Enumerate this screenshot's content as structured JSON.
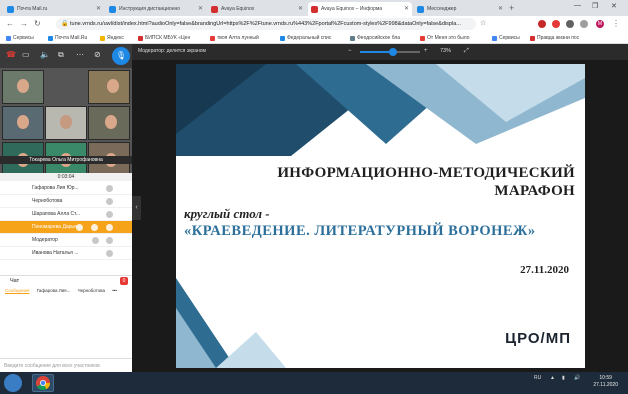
{
  "browser": {
    "tabs": [
      {
        "label": "Почта Mail.ru",
        "color": "#1e88e5"
      },
      {
        "label": "Инструкция дистанционно",
        "color": "#1e88e5"
      },
      {
        "label": "Avaya Equinox",
        "color": "#d32f2f"
      },
      {
        "label": "Avaya Equinox – Информа",
        "color": "#d32f2f"
      },
      {
        "label": "Мессенджер",
        "color": "#1e88e5"
      }
    ],
    "new_tab": "+",
    "url": "tune.vrnds.ru/uwl/dist/index.html?audioOnly=false&brandingUrl=https%2F%2Ftune.vrnds.ru%443%2Fportal%2Fcustom-styles%2F998&dataOnly=false&displa...",
    "avatar_letter": "M"
  },
  "bookmarks": [
    {
      "label": "Сервисы",
      "color": "#4285f4"
    },
    {
      "label": "Почта Mail.Ru",
      "color": "#1e88e5"
    },
    {
      "label": "Яндекс",
      "color": "#f4b400"
    },
    {
      "label": "БИПСК МБУК «Цен",
      "color": "#d32f2f"
    },
    {
      "label": "твоя Алта лунный",
      "color": "#e53935"
    },
    {
      "label": "Федеральный спис",
      "color": "#1e88e5"
    },
    {
      "label": "Феодосийское бла",
      "color": "#607d8b"
    },
    {
      "label": "От Меня это было",
      "color": "#e53935"
    },
    {
      "label": "Сервисы",
      "color": "#4285f4"
    },
    {
      "label": "Правда жизни пос",
      "color": "#d32f2f"
    }
  ],
  "meeting": {
    "moderator_label": "Модератор: делится экраном",
    "zoom": "73%",
    "zoom_fraction": 0.55,
    "active_speaker": "Токарева Ольга Митрофановна",
    "timer": "0:03:04",
    "participants": [
      {
        "name": "Гафарова Лия Юр..."
      },
      {
        "name": "Черноботова"
      },
      {
        "name": "Шарапова Алла Ст..."
      },
      {
        "name": "Пономарева Дарья ...",
        "highlighted": true
      },
      {
        "name": "Модератор"
      },
      {
        "name": "Иванова Наталья ..."
      }
    ],
    "chat": {
      "title": "Чат",
      "badge": "0",
      "tabs": [
        "Сообщения",
        "Гафарова Лия...",
        "Черноботова",
        "•••"
      ],
      "input_placeholder": "Введите сообщение для всех участников"
    }
  },
  "slide": {
    "title": "ИНФОРМАЦИОННО-МЕТОДИЧЕСКИЙ МАРАФОН",
    "subtitle_line1": "круглый стол -",
    "subtitle_line2": "«КРАЕВЕДЕНИЕ. ЛИТЕРАТУРНЫЙ ВОРОНЕЖ»",
    "date": "27.11.2020",
    "logo": "ЦРО/МП"
  },
  "taskbar": {
    "lang": "RU",
    "time": "10:59",
    "date": "27.11.2020"
  }
}
